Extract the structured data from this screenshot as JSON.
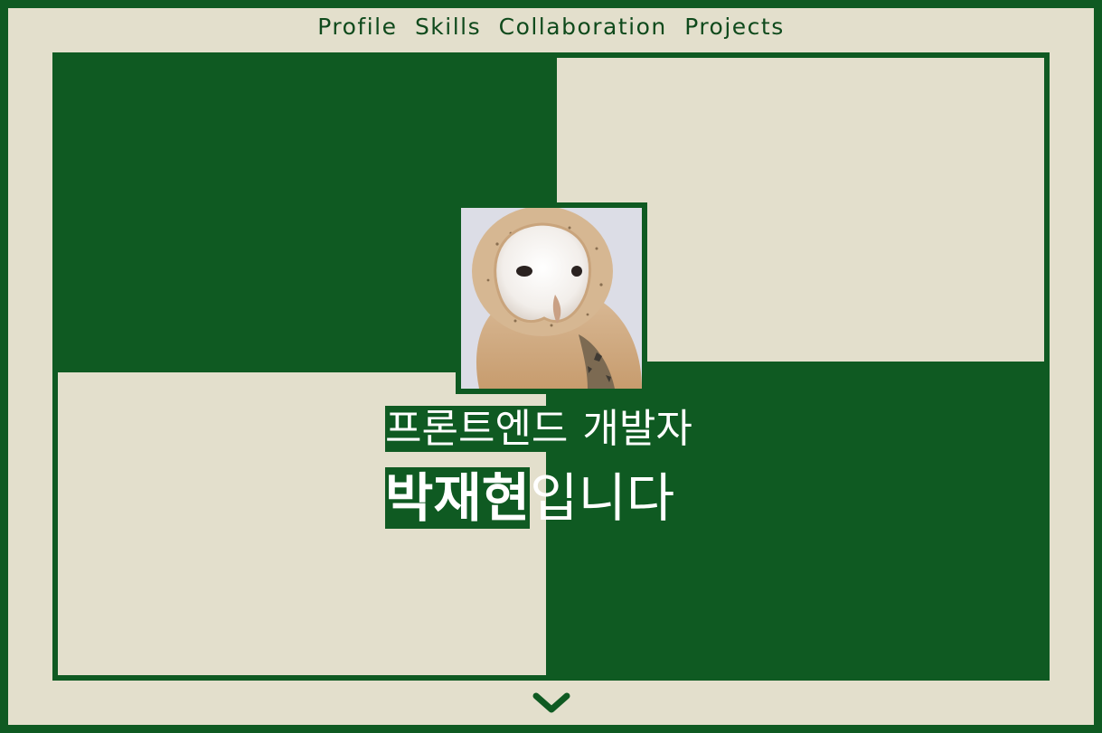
{
  "nav": {
    "items": [
      "Profile",
      "Skills",
      "Collaboration",
      "Projects"
    ]
  },
  "hero": {
    "role_highlight": "프론트엔드",
    "role_rest": " 개발자",
    "name": "박재현",
    "suffix": "입니다",
    "photo_alt": "barn owl profile photo"
  },
  "icons": {
    "scroll": "chevron-down-icon"
  },
  "colors": {
    "green": "#0f5a22",
    "cream": "#e3dfcc",
    "text_light": "#ffffff",
    "nav_text": "#0f4a1c"
  }
}
